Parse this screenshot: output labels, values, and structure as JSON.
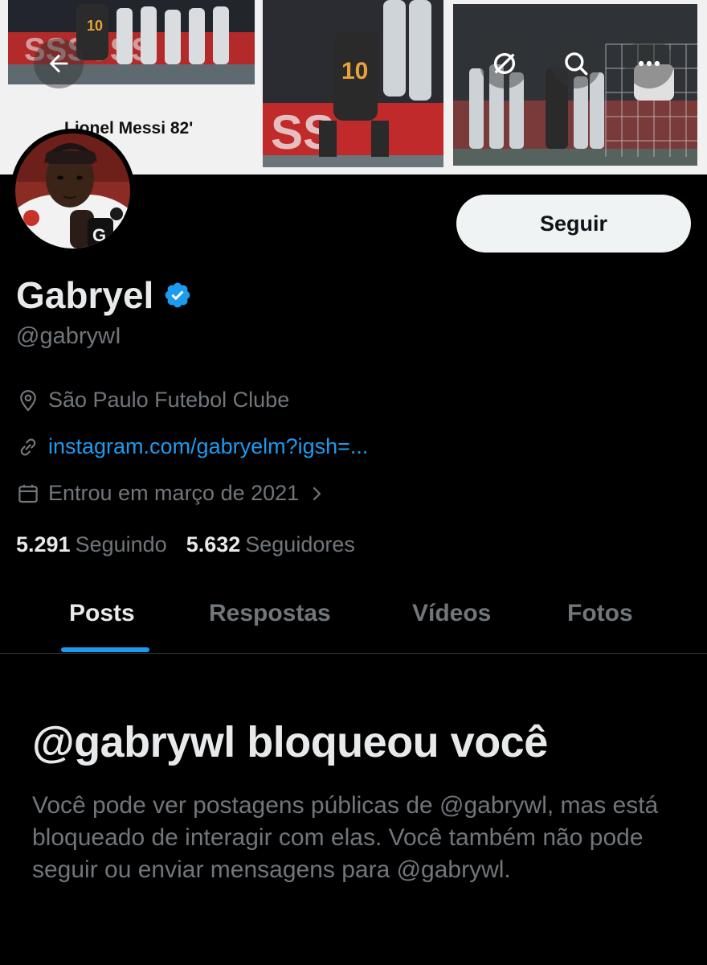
{
  "banner": {
    "caption": "Lionel Messi 82'"
  },
  "profile": {
    "display_name": "Gabryel",
    "handle": "@gabrywI",
    "location": "São Paulo Futebol Clube",
    "website": "instagram.com/gabryelm?igsh=...",
    "joined": "Entrou em março de 2021",
    "following_count": "5.291",
    "following_label": "Seguindo",
    "followers_count": "5.632",
    "followers_label": "Seguidores"
  },
  "actions": {
    "follow_label": "Seguir"
  },
  "tabs": [
    {
      "label": "Posts",
      "active": true
    },
    {
      "label": "Respostas",
      "active": false
    },
    {
      "label": "Vídeos",
      "active": false
    },
    {
      "label": "Fotos",
      "active": false
    }
  ],
  "blocked": {
    "title": "@gabrywl bloqueou você",
    "body": "Você pode ver postagens públicas de @gabrywl, mas está bloqueado de interagir com elas. Você também não pode seguir ou enviar mensagens para @gabrywl."
  },
  "colors": {
    "accent": "#1d9bf0",
    "verified": "#1d9bf0",
    "muted": "#71767b",
    "text": "#e7e9ea"
  },
  "icons": [
    "back-arrow-icon",
    "grok-icon",
    "search-icon",
    "more-icon",
    "verified-badge-icon",
    "location-pin-icon",
    "link-icon",
    "calendar-icon",
    "chevron-right-icon"
  ]
}
